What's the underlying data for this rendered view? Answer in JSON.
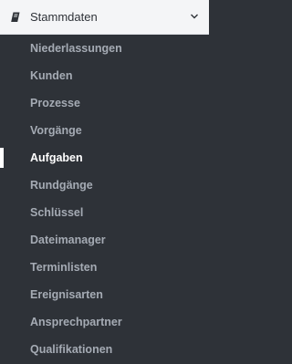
{
  "section": {
    "label": "Stammdaten",
    "icon": "book-icon",
    "expand_icon": "chevron-down-icon",
    "expanded": true
  },
  "items": [
    {
      "label": "Niederlassungen",
      "active": false
    },
    {
      "label": "Kunden",
      "active": false
    },
    {
      "label": "Prozesse",
      "active": false
    },
    {
      "label": "Vorgänge",
      "active": false
    },
    {
      "label": "Aufgaben",
      "active": true
    },
    {
      "label": "Rundgänge",
      "active": false
    },
    {
      "label": "Schlüssel",
      "active": false
    },
    {
      "label": "Dateimanager",
      "active": false
    },
    {
      "label": "Terminlisten",
      "active": false
    },
    {
      "label": "Ereignisarten",
      "active": false
    },
    {
      "label": "Ansprechpartner",
      "active": false
    },
    {
      "label": "Qualifikationen",
      "active": false
    }
  ],
  "colors": {
    "sidebar_bg": "#2e3238",
    "header_bg": "#f4f5f7",
    "item_text": "#a5abb4",
    "active_text": "#ffffff",
    "active_indicator": "#ffffff"
  }
}
